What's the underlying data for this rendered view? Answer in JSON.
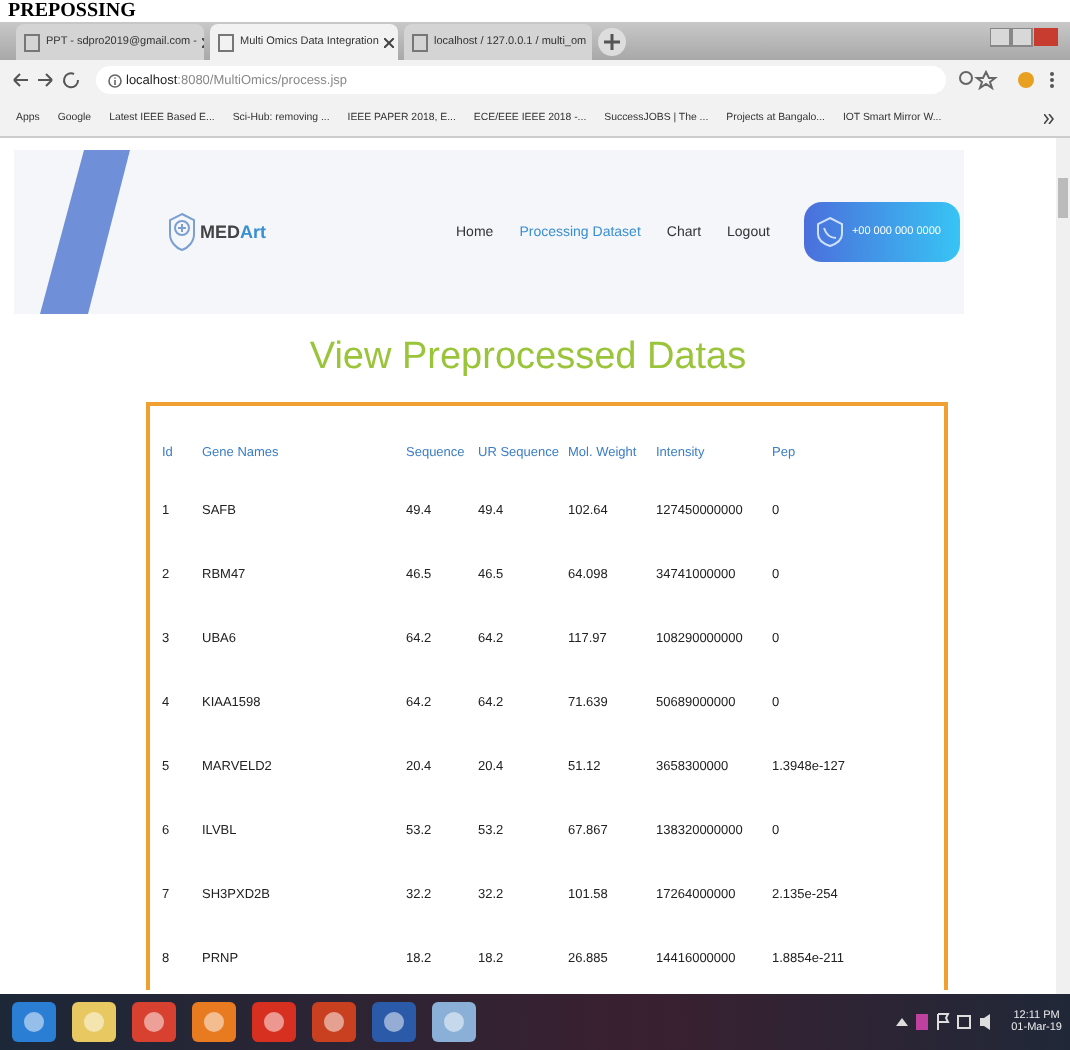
{
  "document_heading": "PREPOSSING",
  "browser": {
    "tabs": [
      {
        "title": "PPT - sdpro2019@gmail.com -",
        "selected": false
      },
      {
        "title": "Multi Omics Data Integration",
        "selected": true
      },
      {
        "title": "localhost / 127.0.0.1 / multi_om",
        "selected": false
      }
    ],
    "address": {
      "host": "localhost",
      "path": ":8080/MultiOmics/process.jsp"
    },
    "bookmarks": [
      "Apps",
      "Google",
      "Latest IEEE Based E...",
      "Sci-Hub: removing ...",
      "IEEE PAPER 2018, E...",
      "ECE/EEE IEEE 2018 -...",
      "SuccessJOBS | The ...",
      "Projects at Bangalo...",
      "IOT Smart Mirror W..."
    ]
  },
  "page": {
    "logo": {
      "main": "MED",
      "accent": "Art"
    },
    "nav": [
      {
        "label": "Home",
        "selected": false
      },
      {
        "label": "Processing Dataset",
        "selected": true
      },
      {
        "label": "Chart",
        "selected": false
      },
      {
        "label": "Logout",
        "selected": false
      }
    ],
    "phone": "+00 000 000 0000",
    "title": "View Preprocessed Datas",
    "table": {
      "columns": [
        "Id",
        "Gene Names",
        "Sequence",
        "UR Sequence",
        "Mol. Weight",
        "Intensity",
        "Pep"
      ],
      "rows": [
        [
          "1",
          "SAFB",
          "49.4",
          "49.4",
          "102.64",
          "127450000000",
          "0"
        ],
        [
          "2",
          "RBM47",
          "46.5",
          "46.5",
          "64.098",
          "34741000000",
          "0"
        ],
        [
          "3",
          "UBA6",
          "64.2",
          "64.2",
          "117.97",
          "108290000000",
          "0"
        ],
        [
          "4",
          "KIAA1598",
          "64.2",
          "64.2",
          "71.639",
          "50689000000",
          "0"
        ],
        [
          "5",
          "MARVELD2",
          "20.4",
          "20.4",
          "51.12",
          "3658300000",
          "1.3948e-127"
        ],
        [
          "6",
          "ILVBL",
          "53.2",
          "53.2",
          "67.867",
          "138320000000",
          "0"
        ],
        [
          "7",
          "SH3PXD2B",
          "32.2",
          "32.2",
          "101.58",
          "17264000000",
          "2.135e-254"
        ],
        [
          "8",
          "PRNP",
          "18.2",
          "18.2",
          "26.885",
          "14416000000",
          "1.8854e-211"
        ]
      ]
    }
  },
  "taskbar": {
    "time": "12:11 PM",
    "date": "01-Mar-19"
  }
}
